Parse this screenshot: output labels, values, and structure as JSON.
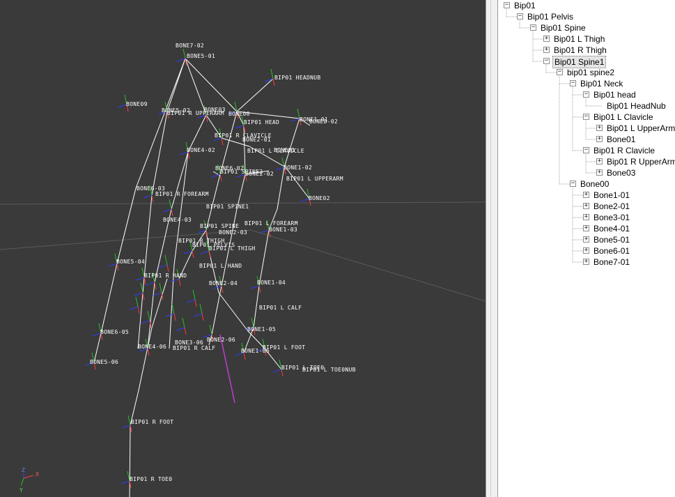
{
  "viewport": {
    "bone_labels": [
      "BONE7-02",
      "BONE5-01",
      "BIP01 HEADNUB",
      "BONE09",
      "BONE5-02",
      "BIP01 R UPPERARM",
      "BONE03",
      "BONE00",
      "BONE1-01",
      "BONE8-02",
      "BIP01 HEAD",
      "BIP01 R CLAVICLE",
      "BONE2-01",
      "BONE01",
      "BONE4-02",
      "BIP01 L CLAVICLE",
      "BONE1-02",
      "BONE6-02",
      "BIP01 SPINE2",
      "BONE2-02",
      "BIP01 L UPPERARM",
      "BONE6-03",
      "BIP01 R FOREARM",
      "BONE02",
      "BIP01 SPINE1",
      "BONE4-03",
      "BIP01 L FOREARM",
      "BIP01 SPINE",
      "BONE2-03",
      "BONE1-03",
      "BIP01 R THIGH",
      "BIP01 PELVIS",
      "BIP01 L THIGH",
      "BONE5-04",
      "BIP01 L HAND",
      "BIP01 R HAND",
      "BONE2-04",
      "BONE1-04",
      "BIP01 L CALF",
      "BONE6-05",
      "BONE1-05",
      "BONE3-06",
      "BONE2-06",
      "BONE4-06",
      "BIP01 R CALF",
      "BIP01 L FOOT",
      "BONE1-06",
      "BONE5-06",
      "BIP01 L TOE0",
      "BIP01 L TOE0NUB",
      "BIP01 R FOOT",
      "BIP01 R TOE0"
    ],
    "axis": {
      "z": "Z",
      "x": "X",
      "y": "Y"
    }
  },
  "tree": {
    "items": [
      {
        "label": "Bip01",
        "level": 0,
        "toggle": "minus"
      },
      {
        "label": "Bip01 Pelvis",
        "level": 1,
        "toggle": "minus"
      },
      {
        "label": "Bip01 Spine",
        "level": 2,
        "toggle": "minus"
      },
      {
        "label": "Bip01 L Thigh",
        "level": 3,
        "toggle": "plus"
      },
      {
        "label": "Bip01 R Thigh",
        "level": 3,
        "toggle": "plus"
      },
      {
        "label": "Bip01 Spine1",
        "level": 3,
        "toggle": "minus",
        "selected": true
      },
      {
        "label": "bip01 spine2",
        "level": 4,
        "toggle": "minus"
      },
      {
        "label": "Bip01 Neck",
        "level": 5,
        "toggle": "minus"
      },
      {
        "label": "Bip01 head",
        "level": 6,
        "toggle": "minus"
      },
      {
        "label": "Bip01 HeadNub",
        "level": 7,
        "toggle": "none"
      },
      {
        "label": "Bip01 L Clavicle",
        "level": 6,
        "toggle": "minus"
      },
      {
        "label": "Bip01 L UpperArm",
        "level": 7,
        "toggle": "plus"
      },
      {
        "label": "Bone01",
        "level": 7,
        "toggle": "plus"
      },
      {
        "label": "Bip01 R Clavicle",
        "level": 6,
        "toggle": "minus"
      },
      {
        "label": "Bip01 R UpperArm",
        "level": 7,
        "toggle": "plus"
      },
      {
        "label": "Bone03",
        "level": 7,
        "toggle": "plus"
      },
      {
        "label": "Bone00",
        "level": 5,
        "toggle": "minus"
      },
      {
        "label": "Bone1-01",
        "level": 6,
        "toggle": "plus"
      },
      {
        "label": "Bone2-01",
        "level": 6,
        "toggle": "plus"
      },
      {
        "label": "Bone3-01",
        "level": 6,
        "toggle": "plus"
      },
      {
        "label": "Bone4-01",
        "level": 6,
        "toggle": "plus"
      },
      {
        "label": "Bone5-01",
        "level": 6,
        "toggle": "plus"
      },
      {
        "label": "Bone6-01",
        "level": 6,
        "toggle": "plus"
      },
      {
        "label": "Bone7-01",
        "level": 6,
        "toggle": "plus"
      }
    ]
  },
  "colors": {
    "viewport_bg": "#3a3a3a",
    "bone_line": "#ffffff",
    "axis_x": "#ff3b3b",
    "axis_y": "#22c322",
    "axis_z": "#2f3cff",
    "highlight_bone": "#c23ccf",
    "grid": "#5a5a5a"
  }
}
